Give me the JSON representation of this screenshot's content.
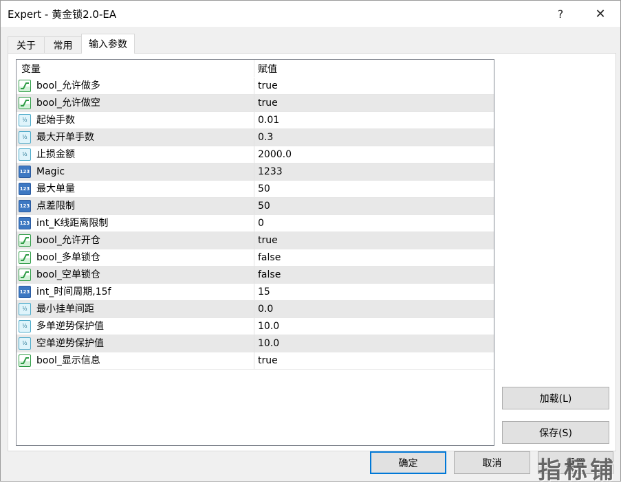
{
  "window": {
    "title": "Expert - 黄金锁2.0-EA",
    "help_label": "?",
    "close_label": "✕"
  },
  "tabs": [
    {
      "label": "关于",
      "active": false
    },
    {
      "label": "常用",
      "active": false
    },
    {
      "label": "输入参数",
      "active": true
    }
  ],
  "table": {
    "headers": {
      "variable": "变量",
      "value": "赋值"
    },
    "rows": [
      {
        "icon": "bool-icon",
        "name": "bool_允许做多",
        "value": "true"
      },
      {
        "icon": "bool-icon",
        "name": "bool_允许做空",
        "value": "true"
      },
      {
        "icon": "double-icon",
        "name": "起始手数",
        "value": "0.01"
      },
      {
        "icon": "double-icon",
        "name": "最大开单手数",
        "value": "0.3"
      },
      {
        "icon": "double-icon",
        "name": "止损金额",
        "value": "2000.0"
      },
      {
        "icon": "int-icon",
        "name": "Magic",
        "value": "1233"
      },
      {
        "icon": "int-icon",
        "name": "最大单量",
        "value": "50"
      },
      {
        "icon": "int-icon",
        "name": "点差限制",
        "value": "50"
      },
      {
        "icon": "int-icon",
        "name": "int_K线距离限制",
        "value": "0"
      },
      {
        "icon": "bool-icon",
        "name": "bool_允许开仓",
        "value": "true"
      },
      {
        "icon": "bool-icon",
        "name": "bool_多单锁仓",
        "value": "false"
      },
      {
        "icon": "bool-icon",
        "name": "bool_空单锁仓",
        "value": "false"
      },
      {
        "icon": "int-icon",
        "name": "int_时间周期,15f",
        "value": "15"
      },
      {
        "icon": "double-icon",
        "name": "最小挂单间距",
        "value": "0.0"
      },
      {
        "icon": "double-icon",
        "name": "多单逆势保护值",
        "value": "10.0"
      },
      {
        "icon": "double-icon",
        "name": "空单逆势保护值",
        "value": "10.0"
      },
      {
        "icon": "bool-icon",
        "name": "bool_显示信息",
        "value": "true"
      }
    ]
  },
  "buttons": {
    "load": "加载(L)",
    "save": "保存(S)",
    "ok": "确定",
    "cancel": "取消",
    "reset": "重置"
  },
  "icon_text": {
    "double": "½",
    "int": "123"
  },
  "watermark": "指标铺",
  "colors": {
    "accent": "#0078d7",
    "bool_green": "#2e9b45",
    "int_blue": "#3d78c2",
    "double_cyan": "#4aa9c9"
  }
}
